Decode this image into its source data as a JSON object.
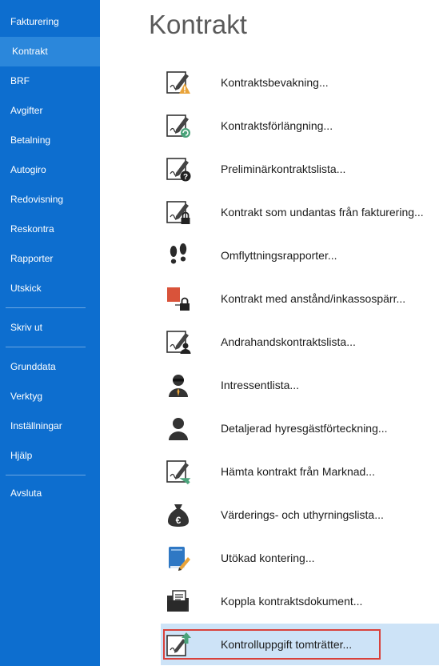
{
  "sidebar": {
    "items": [
      {
        "label": "Fakturering"
      },
      {
        "label": "Kontrakt"
      },
      {
        "label": "BRF"
      },
      {
        "label": "Avgifter"
      },
      {
        "label": "Betalning"
      },
      {
        "label": "Autogiro"
      },
      {
        "label": "Redovisning"
      },
      {
        "label": "Reskontra"
      },
      {
        "label": "Rapporter"
      },
      {
        "label": "Utskick"
      },
      {
        "label": "Skriv ut"
      },
      {
        "label": "Grunddata"
      },
      {
        "label": "Verktyg"
      },
      {
        "label": "Inställningar"
      },
      {
        "label": "Hjälp"
      },
      {
        "label": "Avsluta"
      }
    ],
    "active": "Kontrakt",
    "accent": "#0d6ecf"
  },
  "main": {
    "title": "Kontrakt",
    "items": [
      {
        "label": "Kontraktsbevakning...",
        "icon": "contract-warning-icon"
      },
      {
        "label": "Kontraktsförlängning...",
        "icon": "contract-renew-icon"
      },
      {
        "label": "Preliminärkontraktslista...",
        "icon": "contract-question-icon"
      },
      {
        "label": "Kontrakt som undantas från fakturering...",
        "icon": "contract-lock-icon"
      },
      {
        "label": "Omflyttningsrapporter...",
        "icon": "footprints-icon"
      },
      {
        "label": "Kontrakt med anstånd/inkassospärr...",
        "icon": "deferral-lock-icon"
      },
      {
        "label": "Andrahandskontraktslista...",
        "icon": "contract-person-icon"
      },
      {
        "label": "Intressentlista...",
        "icon": "agent-icon"
      },
      {
        "label": "Detaljerad hyresgästförteckning...",
        "icon": "person-icon"
      },
      {
        "label": "Hämta kontrakt från Marknad...",
        "icon": "contract-fetch-icon"
      },
      {
        "label": "Värderings- och uthyrningslista...",
        "icon": "money-bag-icon"
      },
      {
        "label": "Utökad kontering...",
        "icon": "ledger-book-icon"
      },
      {
        "label": "Koppla kontraktsdokument...",
        "icon": "folder-document-icon"
      },
      {
        "label": "Kontrolluppgift tomträtter...",
        "icon": "contract-upload-icon"
      }
    ],
    "highlighted": "Kontrolluppgift tomträtter...",
    "highlight_color": "#cde3f7",
    "highlight_border": "#d9413b"
  }
}
